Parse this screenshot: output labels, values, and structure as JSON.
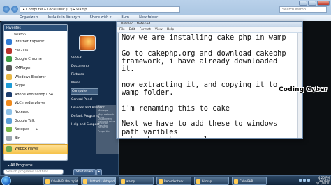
{
  "explorer": {
    "address_path": "▸ Computer ▸ Local Disk (C:) ▸ wamp",
    "search_placeholder": "Search wamp",
    "commands": [
      "Organize ▾",
      "Include in library ▾",
      "Share with ▾",
      "Burn",
      "New folder"
    ]
  },
  "start_menu": {
    "favorites_label": "Favorites",
    "desktop_label": "Desktop",
    "pinned": [
      {
        "label": "Internet Explorer",
        "color": "#2f7bd6"
      },
      {
        "label": "FileZilla",
        "color": "#b8322c"
      },
      {
        "label": "Google Chrome",
        "color": "#3d9c45"
      },
      {
        "label": "KMPlayer",
        "color": "#5a5a5a"
      },
      {
        "label": "Windows Explorer",
        "color": "#e8b847"
      },
      {
        "label": "Skype",
        "color": "#1c9ad6"
      },
      {
        "label": "Adobe Photoshop CS4",
        "color": "#1c3d6e"
      },
      {
        "label": "VLC media player",
        "color": "#f08a1c"
      },
      {
        "label": "Notepad",
        "color": "#8cc1e8"
      },
      {
        "label": "Google Talk",
        "color": "#5a9fd8"
      },
      {
        "label": "Notepad++ ▸",
        "color": "#79b84a"
      },
      {
        "label": "Bin",
        "color": "#9aa5b0"
      },
      {
        "label": "WebEx Player",
        "color": "#6aa84f"
      }
    ],
    "all_programs": "▸  All Programs",
    "search_placeholder": "Search programs and files",
    "right_items": [
      "VEVEK",
      "Documents",
      "Pictures",
      "Music",
      "Computer",
      "Control Panel",
      "Devices and Printers",
      "Default Programs",
      "Help and Support"
    ],
    "submenu_items": [
      "Open",
      "Manage",
      "Map network drive...",
      "Disconnect network drive...",
      "Show on Desktop",
      "Rename",
      "Properties"
    ],
    "shutdown_label": "Shut down",
    "shutdown_arrow": "▸"
  },
  "notepad": {
    "title": "Untitled - Notepad",
    "menus": [
      "File",
      "Edit",
      "Format",
      "View",
      "Help"
    ],
    "text": "Now we are installing cake php in wamp\n\nGo to cakephp.org and download cakephp\nframework, i have already downloaded\nit.\n\nnow extracting it, and copying it to\nwamp folder.\n\ni'm renaming this to cake\n\nNext we have to add these to windows\npath varibles\ncake php, php, mysql\nto run commands through console."
  },
  "watermark": "Coding Cyber",
  "taskbar": {
    "buttons": [
      {
        "label": "CakePHP: the rapid..."
      },
      {
        "label": "Untitled - Notepad"
      },
      {
        "label": "wamp"
      },
      {
        "label": "Recorder task"
      },
      {
        "label": "bitmap"
      },
      {
        "label": "Cake PHP"
      }
    ],
    "clock_time": "4:25 PM",
    "clock_day": "Sunday",
    "clock_date": "7/17/2011"
  }
}
